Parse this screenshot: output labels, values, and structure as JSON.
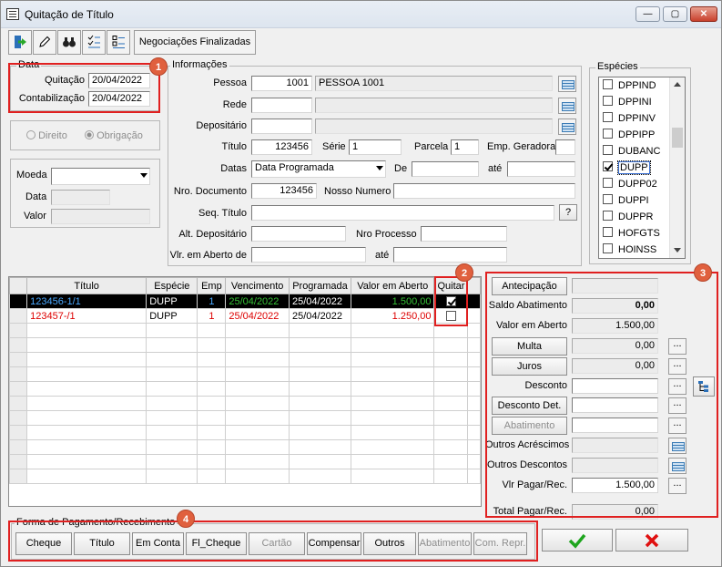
{
  "window": {
    "title": "Quitação de Título",
    "min": "—",
    "max": "▢",
    "close": "✕"
  },
  "toolbar": {
    "negociacoes": "Negociações Finalizadas"
  },
  "data": {
    "legend": "Data",
    "quitacao_label": "Quitação",
    "quitacao_value": "20/04/2022",
    "contab_label": "Contabilização",
    "contab_value": "20/04/2022"
  },
  "direito": {
    "direito_label": "Direito",
    "obrigacao_label": "Obrigação"
  },
  "moeda": {
    "moeda_label": "Moeda",
    "data_label": "Data",
    "valor_label": "Valor"
  },
  "info": {
    "legend": "Informações",
    "pessoa_label": "Pessoa",
    "pessoa_code": "1001",
    "pessoa_name": "PESSOA 1001",
    "rede_label": "Rede",
    "depositario_label": "Depositário",
    "titulo_label": "Título",
    "titulo_value": "123456",
    "serie_label": "Série",
    "serie_value": "1",
    "parcela_label": "Parcela",
    "parcela_value": "1",
    "emp_geradora_label": "Emp. Geradora",
    "datas_label": "Datas",
    "datas_value": "Data Programada",
    "de_label": "De",
    "ate_label": "até",
    "nro_doc_label": "Nro. Documento",
    "nro_doc_value": "123456",
    "nosso_numero_label": "Nosso Numero",
    "seq_titulo_label": "Seq. Título",
    "seq_help": "?",
    "alt_dep_label": "Alt. Depositário",
    "nro_processo_label": "Nro Processo",
    "vlr_aberto_label": "Vlr. em Aberto de",
    "ate2_label": "até"
  },
  "especies": {
    "legend": "Espécies",
    "items": [
      {
        "label": "DPPIND",
        "checked": false
      },
      {
        "label": "DPPINI",
        "checked": false
      },
      {
        "label": "DPPINV",
        "checked": false
      },
      {
        "label": "DPPIPP",
        "checked": false
      },
      {
        "label": "DUBANC",
        "checked": false
      },
      {
        "label": "DUPP",
        "checked": true
      },
      {
        "label": "DUPP02",
        "checked": false
      },
      {
        "label": "DUPPI",
        "checked": false
      },
      {
        "label": "DUPPR",
        "checked": false
      },
      {
        "label": "HOFGTS",
        "checked": false
      },
      {
        "label": "HOINSS",
        "checked": false
      }
    ]
  },
  "grid": {
    "headers": [
      "Título",
      "Espécie",
      "Emp",
      "Vencimento",
      "Programada",
      "Valor em Aberto",
      "Quitar"
    ],
    "rows": [
      {
        "titulo": "123456-1/1",
        "especie": "DUPP",
        "emp": "1",
        "vencimento": "25/04/2022",
        "programada": "25/04/2022",
        "valor": "1.500,00",
        "quitar": true
      },
      {
        "titulo": "123457-/1",
        "especie": "DUPP",
        "emp": "1",
        "vencimento": "25/04/2022",
        "programada": "25/04/2022",
        "valor": "1.250,00",
        "quitar": false
      }
    ]
  },
  "valores": {
    "antecipacao": "Antecipação",
    "saldo_label": "Saldo Abatimento",
    "saldo_value": "0,00",
    "valor_aberto_label": "Valor em Aberto",
    "valor_aberto_value": "1.500,00",
    "multa": "Multa",
    "multa_value": "0,00",
    "juros": "Juros",
    "juros_value": "0,00",
    "desconto_label": "Desconto",
    "desconto_det": "Desconto Det.",
    "abatimento": "Abatimento",
    "outros_acr_label": "Outros Acréscimos",
    "outros_desc_label": "Outros Descontos",
    "vlr_pagar_label": "Vlr Pagar/Rec.",
    "vlr_pagar_value": "1.500,00",
    "total_label": "Total Pagar/Rec.",
    "total_value": "0,00",
    "dots": "..."
  },
  "forma": {
    "legend": "Forma de Pagamento/Recebimento",
    "buttons": [
      "Cheque",
      "Título",
      "Em Conta",
      "Fl_Cheque",
      "Cartão",
      "Compensar",
      "Outros",
      "Abatimento",
      "Com. Repr."
    ]
  },
  "badges": [
    "1",
    "2",
    "3",
    "4"
  ],
  "colors": {
    "highlight": "#e02020",
    "badge": "#e0603e",
    "ok": "#1ea51e",
    "cancel": "#e01010"
  }
}
